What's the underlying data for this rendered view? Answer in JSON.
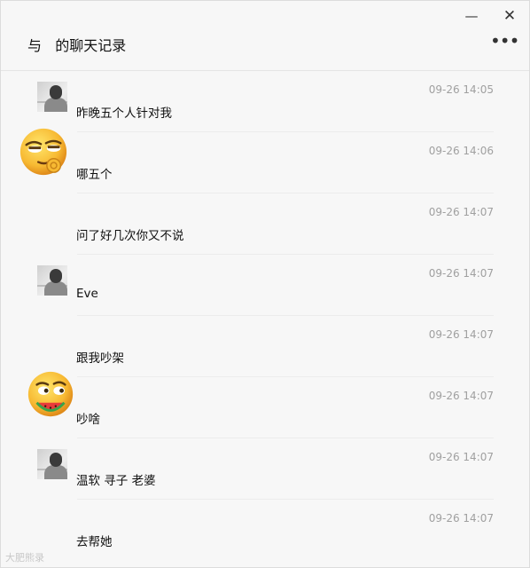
{
  "window": {
    "title": "与   的聊天记录",
    "minimize_icon": "—",
    "close_icon": "✕",
    "more_icon": "•••"
  },
  "messages": [
    {
      "time": "09-26 14:05",
      "text": "昨晚五个人针对我",
      "avatar": "photo-avatar"
    },
    {
      "time": "09-26 14:06",
      "text": "哪五个",
      "avatar": "smirk-emoji-avatar"
    },
    {
      "time": "09-26 14:07",
      "text": "问了好几次你又不说",
      "avatar": ""
    },
    {
      "time": "09-26 14:07",
      "text": "Eve",
      "avatar": "photo-avatar"
    },
    {
      "time": "09-26 14:07",
      "text": "跟我吵架",
      "avatar": ""
    },
    {
      "time": "09-26 14:07",
      "text": "吵啥",
      "avatar": "watermelon-emoji-avatar"
    },
    {
      "time": "09-26 14:07",
      "text": "温软 寻子 老婆",
      "avatar": "photo-avatar"
    },
    {
      "time": "09-26 14:07",
      "text": "去帮她",
      "avatar": ""
    }
  ],
  "watermark": "大肥熊录"
}
